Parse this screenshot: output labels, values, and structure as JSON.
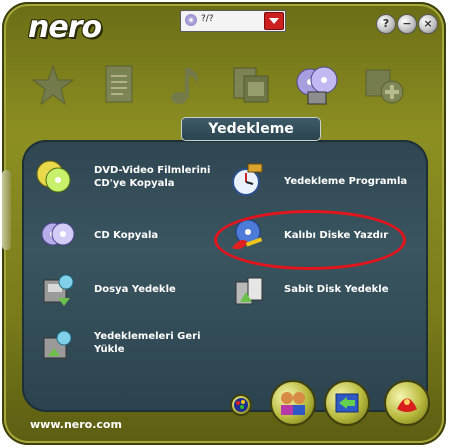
{
  "app": {
    "brand": "nero",
    "footer_link": "www.nero.com"
  },
  "drive_selector": {
    "value": "?/?"
  },
  "window_controls": {
    "help": "?",
    "minimize": "−",
    "close": "×"
  },
  "nav_tabs": [
    {
      "name": "favorites",
      "icon": "star-icon"
    },
    {
      "name": "data",
      "icon": "document-icon"
    },
    {
      "name": "audio",
      "icon": "music-note-icon"
    },
    {
      "name": "photo-video",
      "icon": "film-photo-icon"
    },
    {
      "name": "backup",
      "icon": "discs-icon",
      "active": true
    },
    {
      "name": "extras",
      "icon": "add-icon"
    }
  ],
  "section": {
    "title": "Yedekleme"
  },
  "tasks": [
    {
      "label_line1": "DVD-Video Filmlerini",
      "label_line2": "CD'ye Kopyala",
      "icon": "dvd-to-cd-icon"
    },
    {
      "label_line1": "Yedekleme Programla",
      "icon": "scheduled-backup-icon"
    },
    {
      "label_line1": "CD Kopyala",
      "icon": "copy-cd-icon"
    },
    {
      "label_line1": "Kalıbı Diske Yazdır",
      "icon": "burn-image-icon",
      "highlighted": true
    },
    {
      "label_line1": "Dosya Yedekle",
      "icon": "file-backup-icon"
    },
    {
      "label_line1": "Sabit Disk Yedekle",
      "icon": "hard-disk-backup-icon"
    },
    {
      "label_line1": "Yedeklemeleri Geri",
      "label_line2": "Yükle",
      "icon": "restore-backup-icon"
    }
  ],
  "bottom_buttons": [
    {
      "icon": "palette-icon"
    },
    {
      "icon": "users-icon"
    },
    {
      "icon": "refresh-icon"
    },
    {
      "icon": "exit-icon"
    }
  ],
  "colors": {
    "frame": "#7f8120",
    "panel": "#2f4651",
    "highlight": "#e3141c"
  }
}
